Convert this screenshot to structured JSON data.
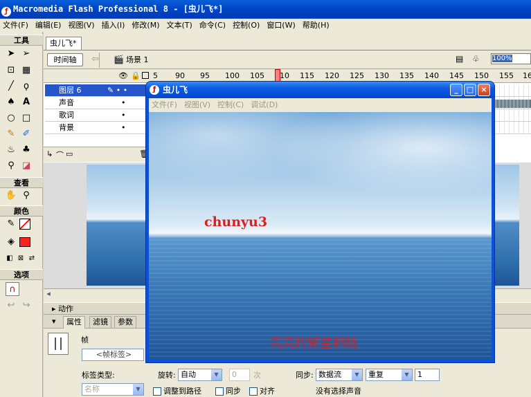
{
  "window": {
    "title": "Macromedia Flash Professional 8 - [虫儿飞*]"
  },
  "menu": [
    "文件(F)",
    "编辑(E)",
    "视图(V)",
    "插入(I)",
    "修改(M)",
    "文本(T)",
    "命令(C)",
    "控制(O)",
    "窗口(W)",
    "帮助(H)"
  ],
  "tools": {
    "header": "工具",
    "view_label": "查看",
    "color_label": "颜色",
    "options_label": "选项"
  },
  "document": {
    "tab": "虫儿飞*",
    "timeline_button": "时间轴",
    "scene": "场景 1",
    "zoom": "100%"
  },
  "ruler": [
    "5",
    "90",
    "95",
    "100",
    "105",
    "110",
    "115",
    "120",
    "125",
    "130",
    "135",
    "140",
    "145",
    "150",
    "155",
    "16"
  ],
  "layers": [
    "图层 6",
    "声音",
    "歌词",
    "背景"
  ],
  "panels": {
    "actions": "动作",
    "tab_properties": "属性",
    "tab_filters": "滤镜",
    "tab_params": "参数"
  },
  "properties": {
    "frame_label": "帧",
    "frame_label_placeholder": "<帧标签>",
    "label_type": "标签类型:",
    "name_value": "名称",
    "rotate_label": "旋转:",
    "rotate_value": "自动",
    "times_value": "0",
    "times_unit": "次",
    "orient_to_path": "调整到路径",
    "sync": "同步",
    "snap": "对齐",
    "sync_label": "同步:",
    "sync_value": "数据流",
    "repeat_value": "重复",
    "repeat_count": "1",
    "no_sound": "没有选择声音"
  },
  "player": {
    "title": "虫儿飞",
    "menu": [
      "文件(F)",
      "视图(V)",
      "控制(C)",
      "调试(D)"
    ],
    "text1": "chunyu3",
    "text2": "亮亮的繁星相随"
  },
  "colors": {
    "stroke": "#000000",
    "fill": "#ff2020",
    "lyric": "#d82020"
  }
}
